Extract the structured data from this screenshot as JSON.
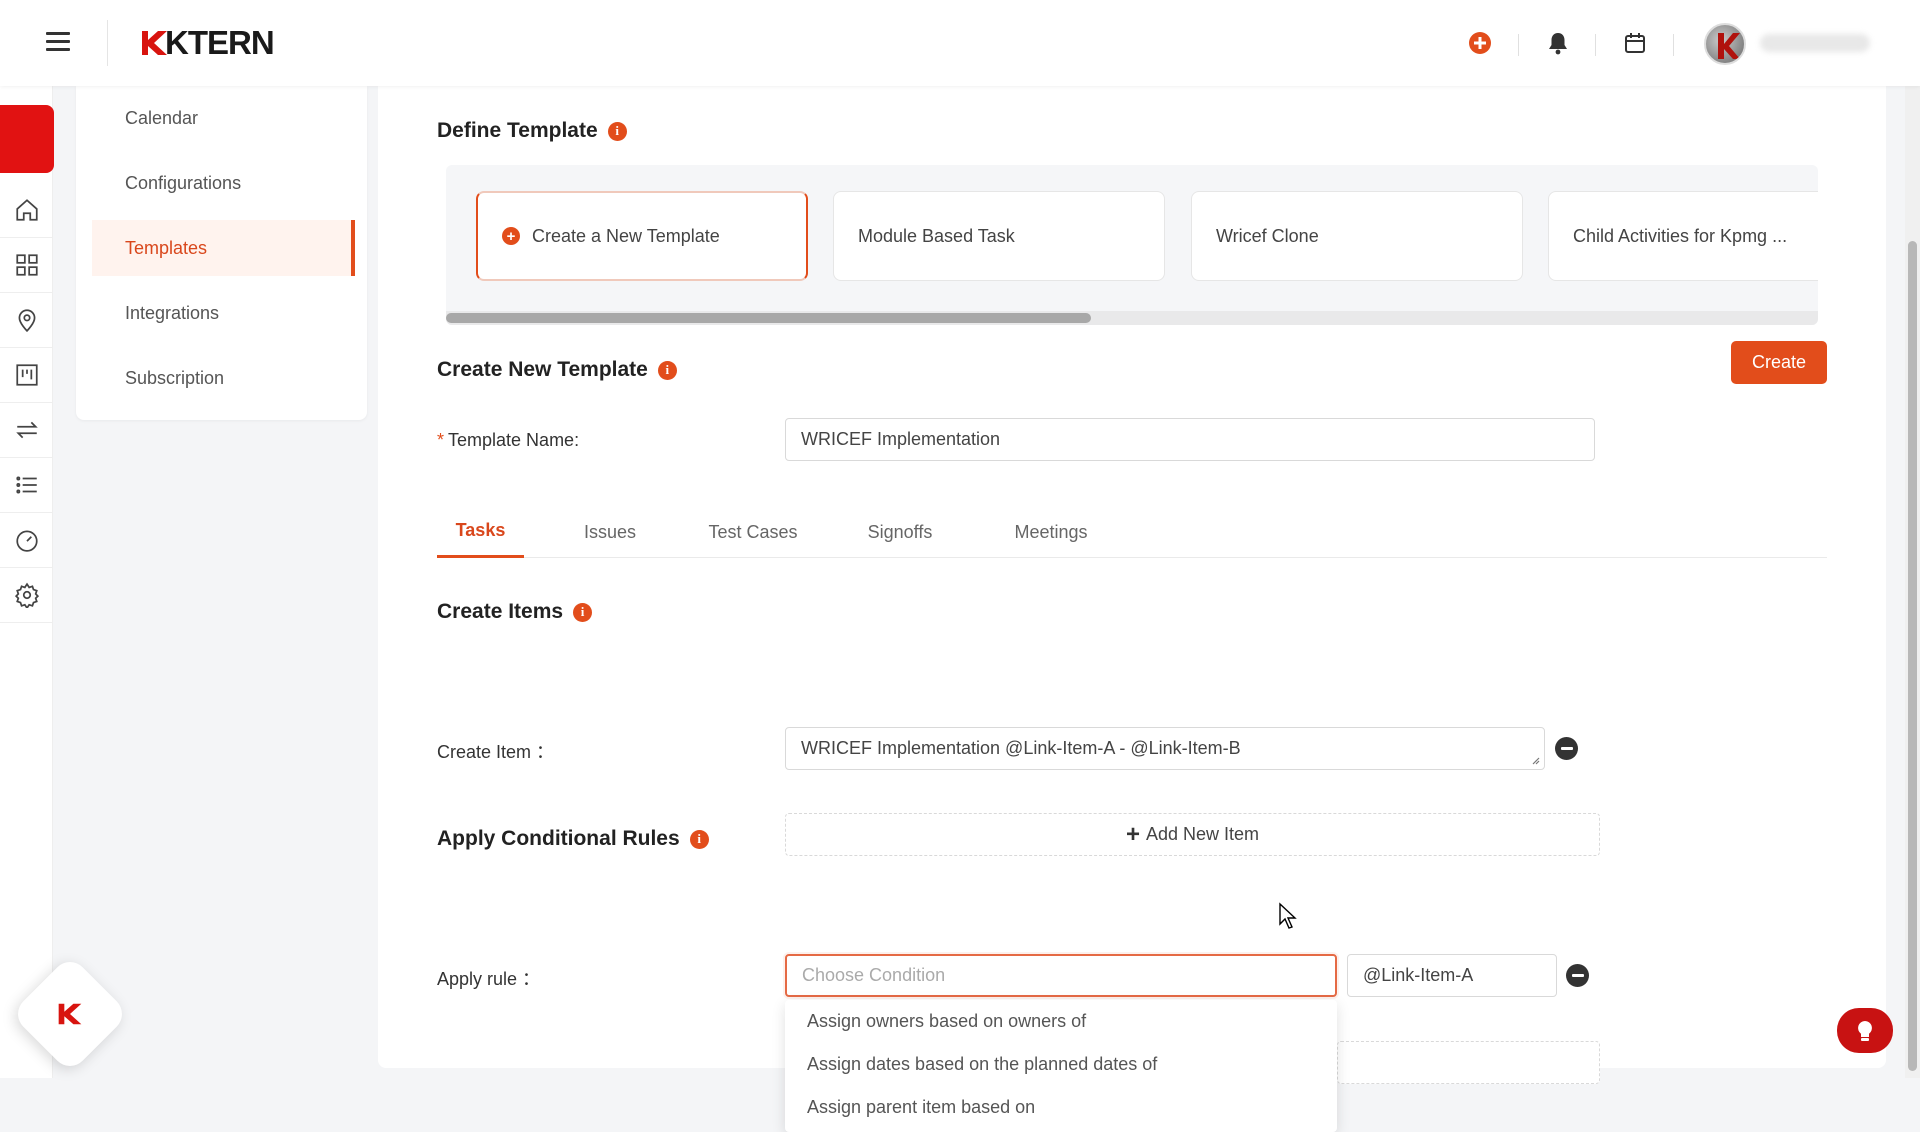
{
  "app": {
    "brand": "KTERN"
  },
  "topbar": {
    "icons": [
      "add-circle-icon",
      "bell-icon",
      "calendar-icon"
    ],
    "accent": "#e24d1b"
  },
  "subnav": {
    "items": [
      {
        "label": "Calendar"
      },
      {
        "label": "Configurations"
      },
      {
        "label": "Templates"
      },
      {
        "label": "Integrations"
      },
      {
        "label": "Subscription"
      }
    ],
    "active": "Templates"
  },
  "define_template": {
    "title": "Define Template",
    "cards": [
      {
        "label": "Create a New Template"
      },
      {
        "label": "Module Based Task"
      },
      {
        "label": "Wricef Clone"
      },
      {
        "label": "Child Activities for Kpmg ..."
      }
    ],
    "scroll_fraction": 0.47
  },
  "create_template": {
    "title": "Create New Template",
    "create_button": "Create",
    "template_name_label": "Template Name",
    "template_name_colon": ":",
    "template_name_value": "WRICEF Implementation"
  },
  "tabs": [
    {
      "label": "Tasks"
    },
    {
      "label": "Issues"
    },
    {
      "label": "Test Cases"
    },
    {
      "label": "Signoffs"
    },
    {
      "label": "Meetings"
    }
  ],
  "active_tab": "Tasks",
  "create_items": {
    "title": "Create Items",
    "item_label": "Create Item ：",
    "item_value": "WRICEF Implementation @Link-Item-A - @Link-Item-B",
    "add_new_label": "Add New Item"
  },
  "conditional_rules": {
    "title": "Apply Conditional Rules",
    "rule_label": "Apply rule ：",
    "condition_placeholder": "Choose Condition",
    "link_value": "@Link-Item-A",
    "options": [
      "Assign owners based on owners of",
      "Assign dates based on the planned dates of",
      "Assign parent item based on"
    ]
  }
}
